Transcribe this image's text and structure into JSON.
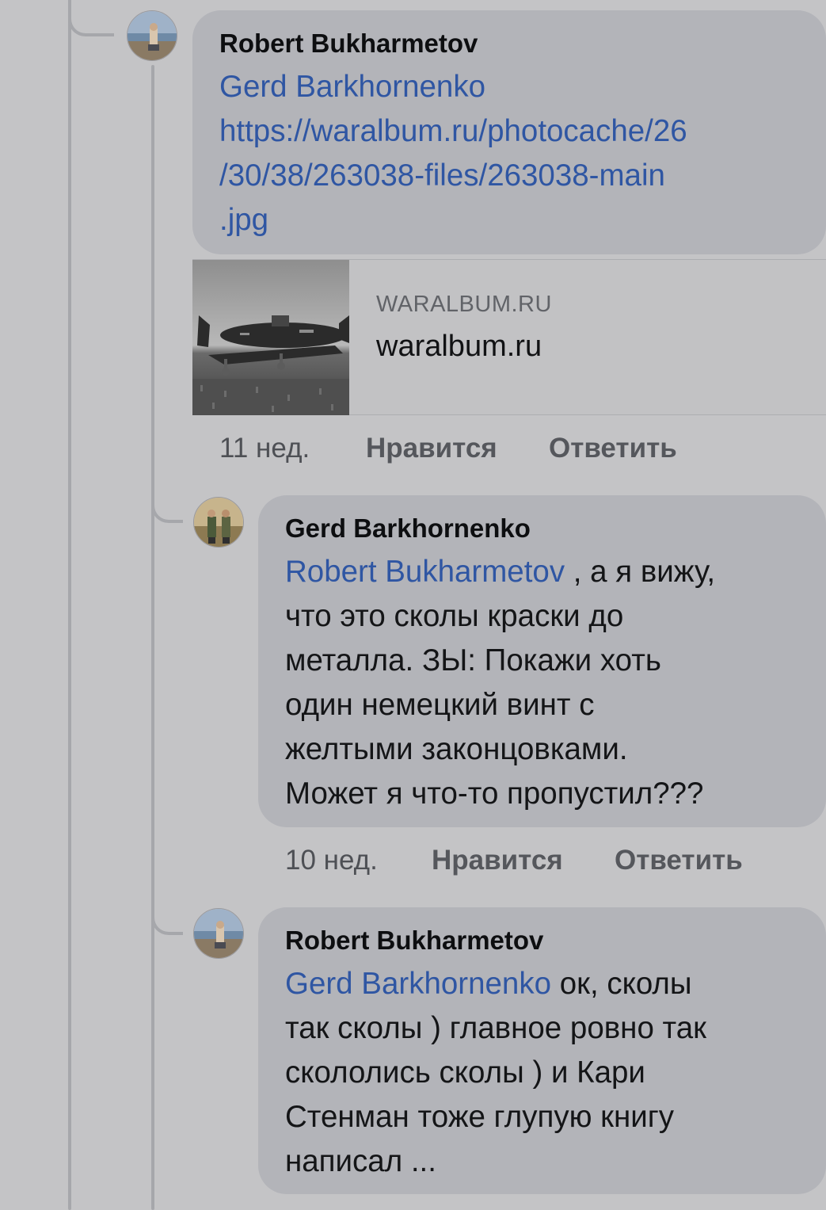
{
  "comments": [
    {
      "author": "Robert Bukharmetov",
      "mention": "Gerd Barkhornenko",
      "link_lines": [
        "https://waralbum.ru/photocache/26",
        "/30/38/263038-files/263038-main",
        ".jpg"
      ],
      "preview": {
        "domain": "WARALBUM.RU",
        "title": "waralbum.ru",
        "image_icon": "aircraft-photo"
      },
      "time": "11 нед.",
      "like_label": "Нравится",
      "reply_label": "Ответить"
    },
    {
      "author": "Gerd Barkhornenko",
      "mention": "Robert Bukharmetov",
      "first_line_rest": " , а я вижу,",
      "text_lines": [
        "что это сколы краски до",
        "металла. ЗЫ: Покажи хоть",
        "один немецкий винт с",
        "желтыми законцовками.",
        "Может я что-то пропустил???"
      ],
      "time": "10 нед.",
      "like_label": "Нравится",
      "reply_label": "Ответить"
    },
    {
      "author": "Robert Bukharmetov",
      "mention": "Gerd Barkhornenko",
      "first_line_rest": " ок, сколы",
      "text_lines": [
        "так сколы ) главное ровно так",
        "скололись сколы ) и Кари",
        "Стенман тоже глупую книгу",
        "написал ..."
      ]
    }
  ],
  "colors": {
    "background": "#c4c4c6",
    "bubble": "#b3b4b9",
    "mention": "#2f56a3",
    "meta": "#55575c"
  }
}
